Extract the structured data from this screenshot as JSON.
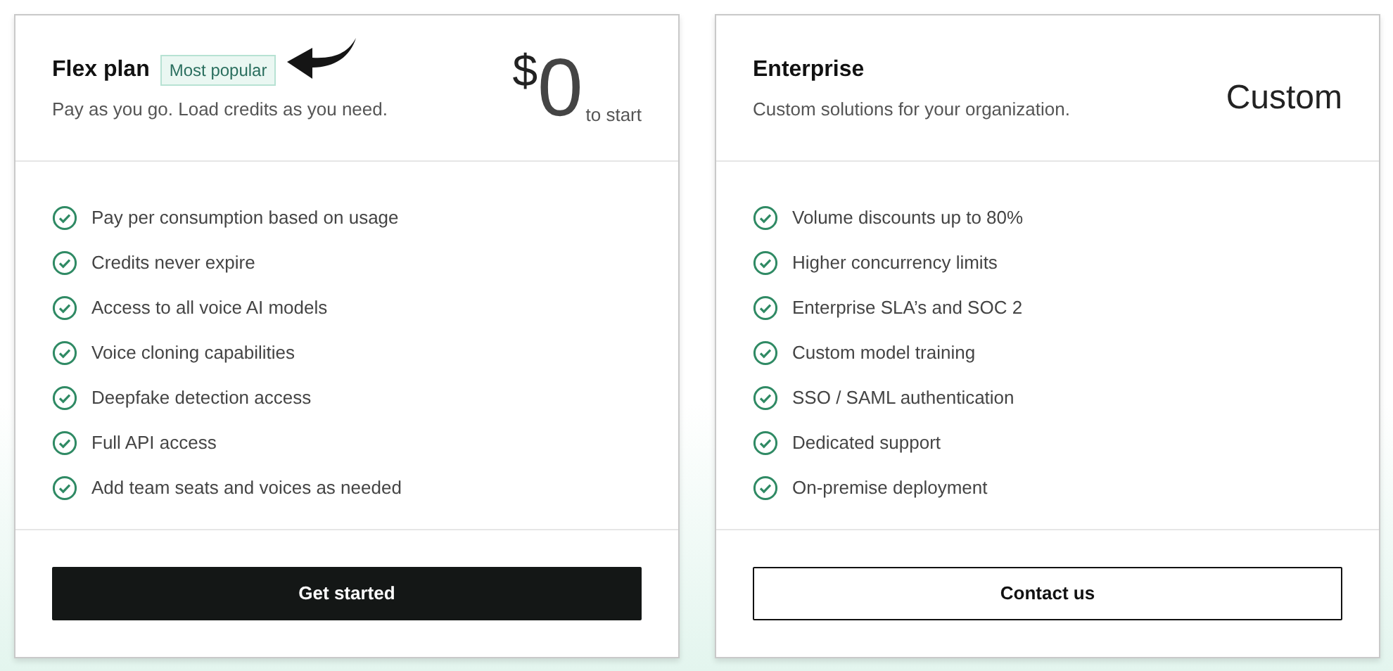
{
  "plans": [
    {
      "name": "Flex plan",
      "badge": "Most popular",
      "description": "Pay as you go. Load credits as you need.",
      "price": {
        "kind": "amount",
        "currency": "$",
        "amount": "0",
        "suffix": "to start"
      },
      "features": [
        "Pay per consumption based on usage",
        "Credits never expire",
        "Access to all voice AI models",
        "Voice cloning capabilities",
        "Deepfake detection access",
        "Full API access",
        "Add team seats and voices as needed"
      ],
      "button": {
        "label": "Get started",
        "kind": "solid"
      }
    },
    {
      "name": "Enterprise",
      "description": "Custom solutions for your organization.",
      "price": {
        "kind": "text",
        "text": "Custom"
      },
      "features": [
        "Volume discounts up to 80%",
        "Higher concurrency limits",
        "Enterprise SLA’s and SOC 2",
        "Custom model training",
        "SSO / SAML authentication",
        "Dedicated support",
        "On-premise deployment"
      ],
      "button": {
        "label": "Contact us",
        "kind": "outline"
      }
    }
  ]
}
